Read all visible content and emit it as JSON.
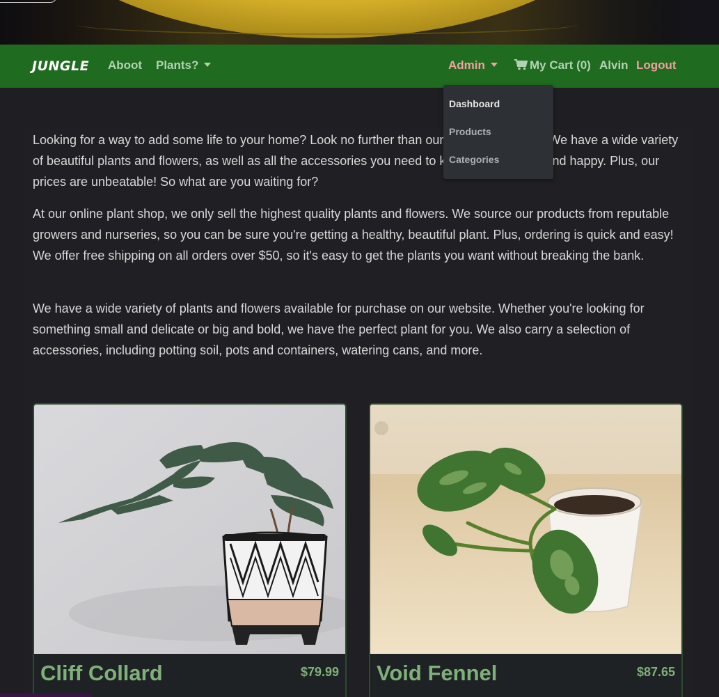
{
  "navbar": {
    "brand": "JUNGLE",
    "about": "Aboot",
    "plants": "Plants?",
    "admin": "Admin",
    "cart": "My Cart (0)",
    "user": "Alvin",
    "logout": "Logout"
  },
  "admin_menu": {
    "items": [
      "Dashboard",
      "Products",
      "Categories"
    ]
  },
  "intro": {
    "p1": "Looking for a way to add some life to your home? Look no further than our online plant shop! We have a wide variety of beautiful plants and flowers, as well as all the accessories you need to keep them healthy and happy. Plus, our prices are unbeatable! So what are you waiting for?",
    "p2": "At our online plant shop, we only sell the highest quality plants and flowers. We source our products from reputable growers and nurseries, so you can be sure you're getting a healthy, beautiful plant. Plus, ordering is quick and easy! We offer free shipping on all orders over $50, so it's easy to get the plants you want without breaking the bank.",
    "p3": "We have a wide variety of plants and flowers available for purchase on our website. Whether you're looking for something small and delicate or big and bold, we have the perfect plant for you. We also carry a selection of accessories, including potting soil, pots and containers, watering cans, and more."
  },
  "products": [
    {
      "name": "Cliff Collard",
      "price": "$79.99"
    },
    {
      "name": "Void Fennel",
      "price": "$87.65"
    }
  ],
  "colors": {
    "navbar": "#1f6b1f",
    "accent_green": "#7fb07a",
    "accent_pink": "#f0a09f"
  }
}
